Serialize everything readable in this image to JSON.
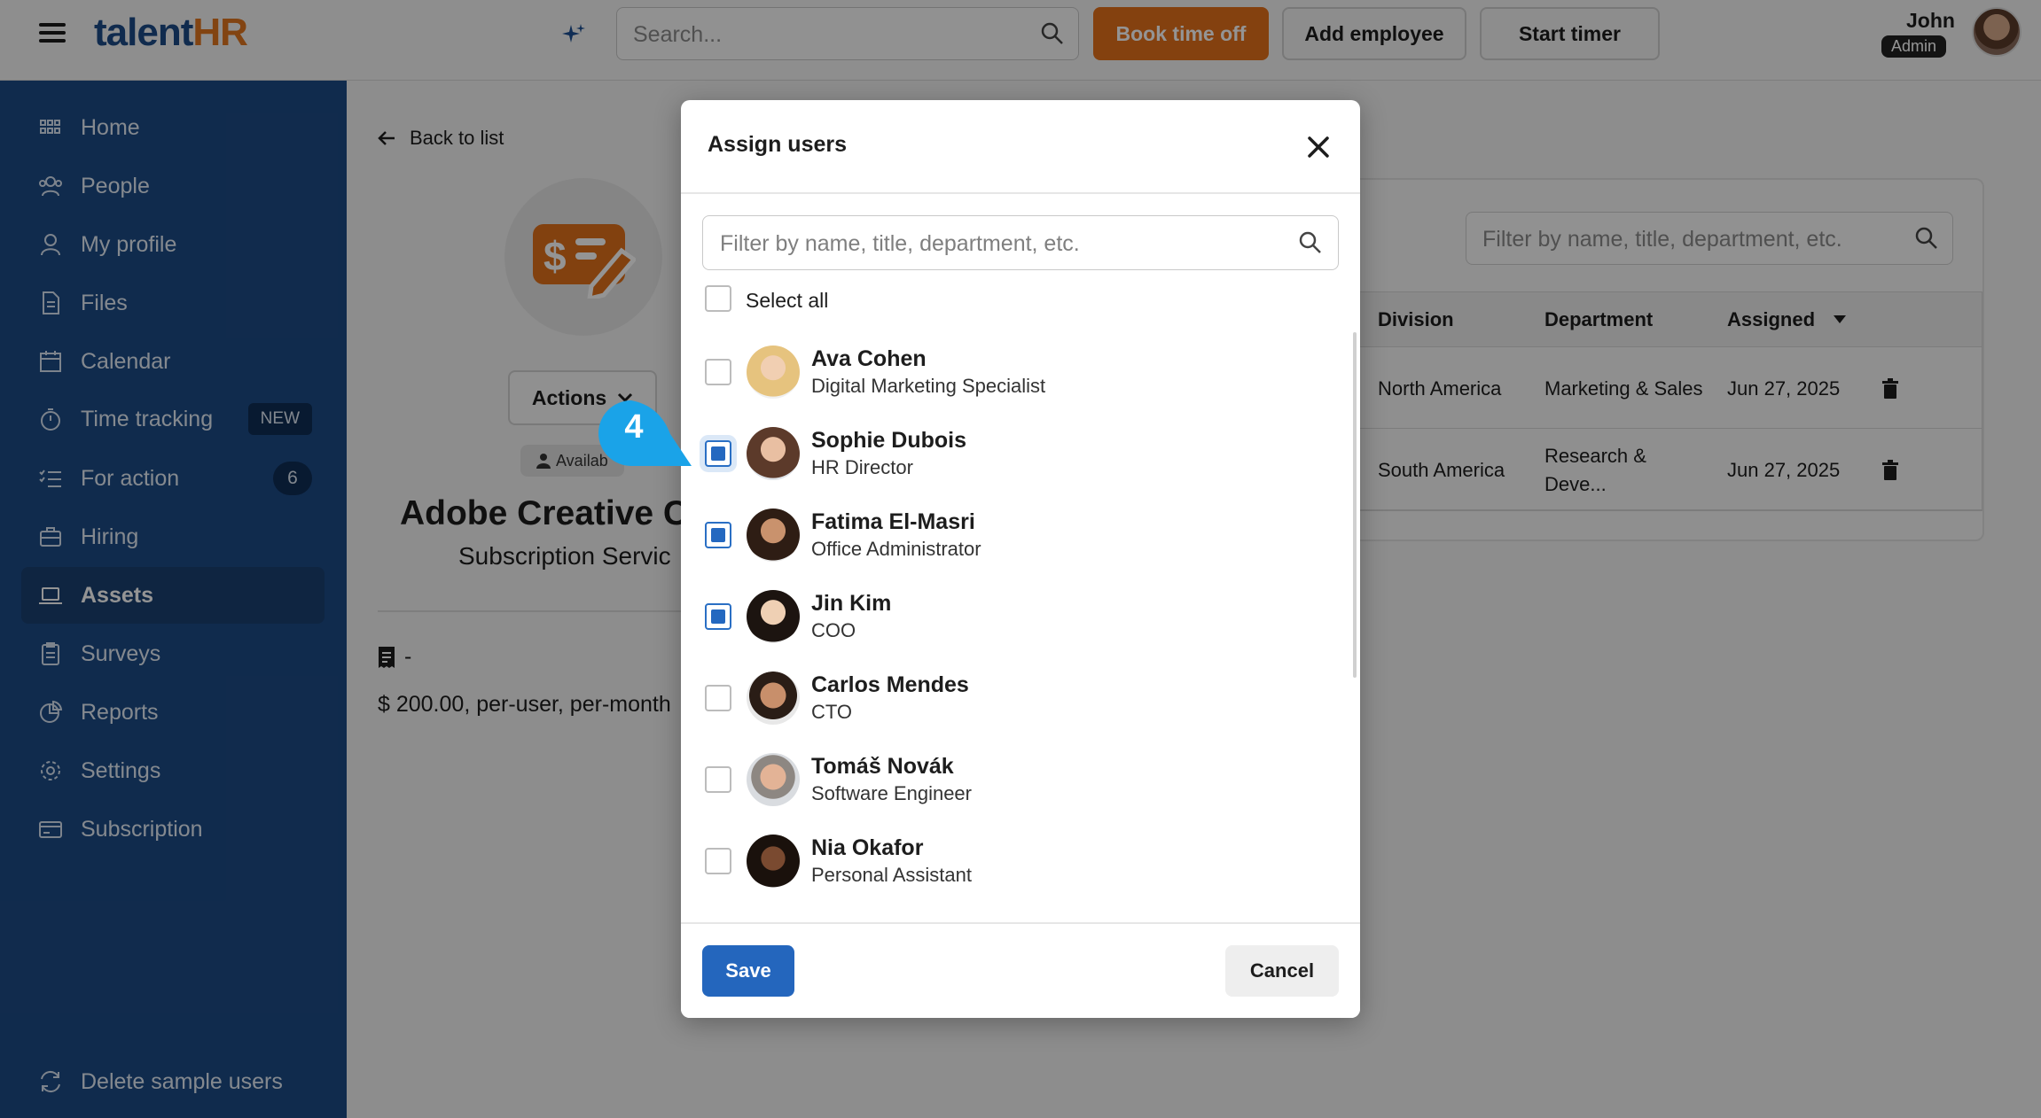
{
  "app": {
    "logo_main": "talent",
    "logo_accent": "HR"
  },
  "topbar": {
    "search_placeholder": "Search...",
    "book_time_off": "Book time off",
    "add_employee": "Add employee",
    "start_timer": "Start timer",
    "user_name": "John",
    "user_role": "Admin"
  },
  "sidebar": {
    "items": [
      {
        "label": "Home",
        "icon": "grid-icon"
      },
      {
        "label": "People",
        "icon": "people-icon"
      },
      {
        "label": "My profile",
        "icon": "person-icon"
      },
      {
        "label": "Files",
        "icon": "file-icon"
      },
      {
        "label": "Calendar",
        "icon": "calendar-icon"
      },
      {
        "label": "Time tracking",
        "icon": "stopwatch-icon",
        "badge": "NEW"
      },
      {
        "label": "For action",
        "icon": "checklist-icon",
        "count": "6"
      },
      {
        "label": "Hiring",
        "icon": "briefcase-icon"
      },
      {
        "label": "Assets",
        "icon": "laptop-icon",
        "active": true
      },
      {
        "label": "Surveys",
        "icon": "clipboard-icon"
      },
      {
        "label": "Reports",
        "icon": "pie-chart-icon"
      },
      {
        "label": "Settings",
        "icon": "gear-icon"
      },
      {
        "label": "Subscription",
        "icon": "card-icon"
      }
    ],
    "footer_label": "Delete sample users"
  },
  "asset": {
    "back_label": "Back to list",
    "actions_label": "Actions",
    "availability": "Availab",
    "title": "Adobe Creative C",
    "subtitle": "Subscription Servic",
    "receipt_value": "-",
    "price": "$ 200.00, per-user, per-month"
  },
  "assignments": {
    "filter_placeholder": "Filter by name, title, department, etc.",
    "columns": [
      "Division",
      "Department",
      "Assigned"
    ],
    "rows": [
      {
        "division": "North America",
        "department": "Marketing & Sales",
        "department_line2": "",
        "assigned": "Jun 27, 2025"
      },
      {
        "division": "South America",
        "department": "Research &",
        "department_line2": "Deve...",
        "assigned": "Jun 27, 2025"
      }
    ]
  },
  "modal": {
    "title": "Assign users",
    "filter_placeholder": "Filter by name, title, department, etc.",
    "select_all": "Select all",
    "users": [
      {
        "name": "Ava Cohen",
        "title": "Digital Marketing Specialist",
        "checked": false
      },
      {
        "name": "Sophie Dubois",
        "title": "HR Director",
        "checked": true
      },
      {
        "name": "Fatima El-Masri",
        "title": "Office Administrator",
        "checked": true
      },
      {
        "name": "Jin Kim",
        "title": "COO",
        "checked": true
      },
      {
        "name": "Carlos Mendes",
        "title": "CTO",
        "checked": false
      },
      {
        "name": "Tomáš Novák",
        "title": "Software Engineer",
        "checked": false
      },
      {
        "name": "Nia Okafor",
        "title": "Personal Assistant",
        "checked": false
      }
    ],
    "save_label": "Save",
    "cancel_label": "Cancel"
  },
  "callout": {
    "step": "4",
    "color": "#1aa3e8"
  },
  "colors": {
    "brand": "#1c4b87",
    "accent": "#e3711b",
    "primary": "#2466bd"
  }
}
